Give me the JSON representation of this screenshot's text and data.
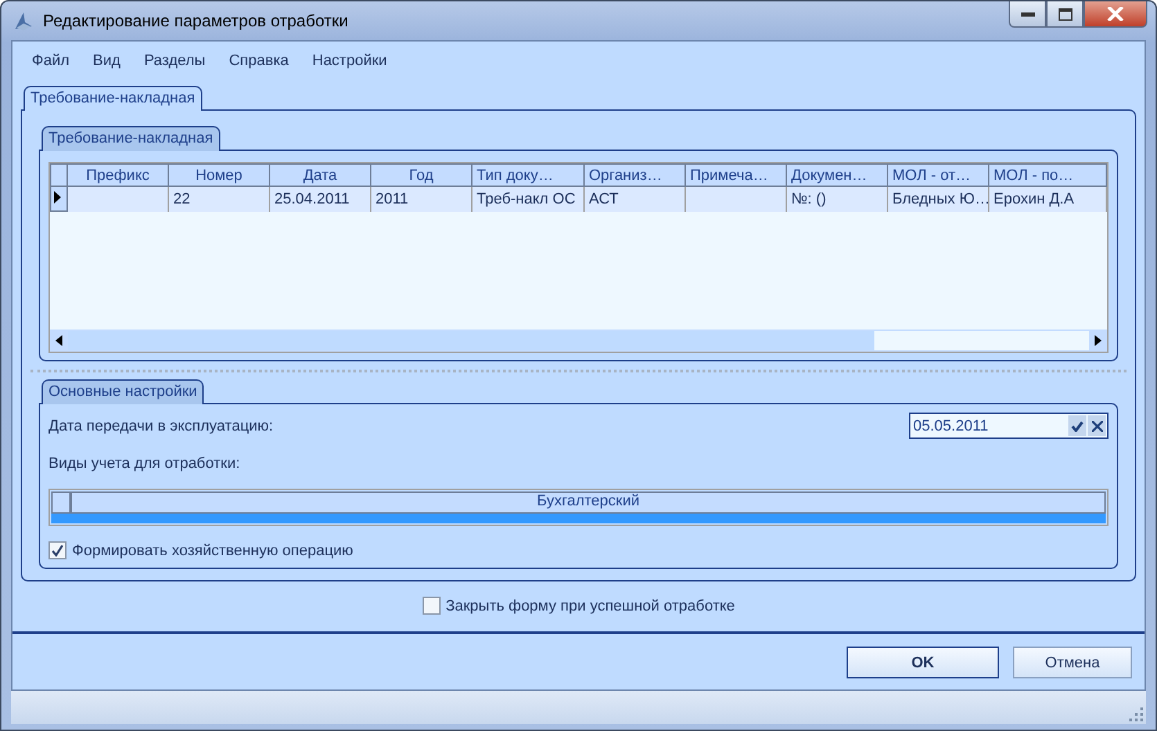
{
  "window": {
    "title": "Редактирование параметров отработки"
  },
  "menu": [
    {
      "label": "Файл"
    },
    {
      "label": "Вид"
    },
    {
      "label": "Разделы"
    },
    {
      "label": "Справка"
    },
    {
      "label": "Настройки"
    }
  ],
  "tabs": [
    {
      "label": "Требование-накладная",
      "selected": true
    }
  ],
  "documents": {
    "tab": "Требование-накладная",
    "table": {
      "columns": [
        "Префикс",
        "Номер",
        "Дата",
        "Год",
        "Тип доку…",
        "Организ…",
        "Примеча…",
        "Докумен…",
        "МОЛ - от…",
        "МОЛ - по…"
      ],
      "rows": [
        {
          "selected": true,
          "cells": [
            null,
            "22",
            "25.04.2011",
            "2011",
            "Треб-накл ОС",
            "АСТ",
            null,
            "№: ()",
            "Бледных Ю…",
            "Ерохин Д.А"
          ]
        }
      ]
    }
  },
  "settings": {
    "title": "Основные настройки",
    "date_label": "Дата передачи в эксплуатацию:",
    "date_value": "05.05.2011",
    "accounting_label": "Виды учета для отработки:",
    "accounting_table": {
      "columns": [
        "Бухгалтерский"
      ],
      "rows": [
        {
          "selected": true
        }
      ]
    },
    "form_operation": {
      "label": "Формировать хозяйственную операцию",
      "checked": true
    }
  },
  "close_on_success": {
    "label": "Закрыть форму при успешной отработке",
    "checked": false
  },
  "buttons": [
    {
      "label": "OK",
      "default": true
    },
    {
      "label": "Отмена",
      "default": false
    }
  ]
}
